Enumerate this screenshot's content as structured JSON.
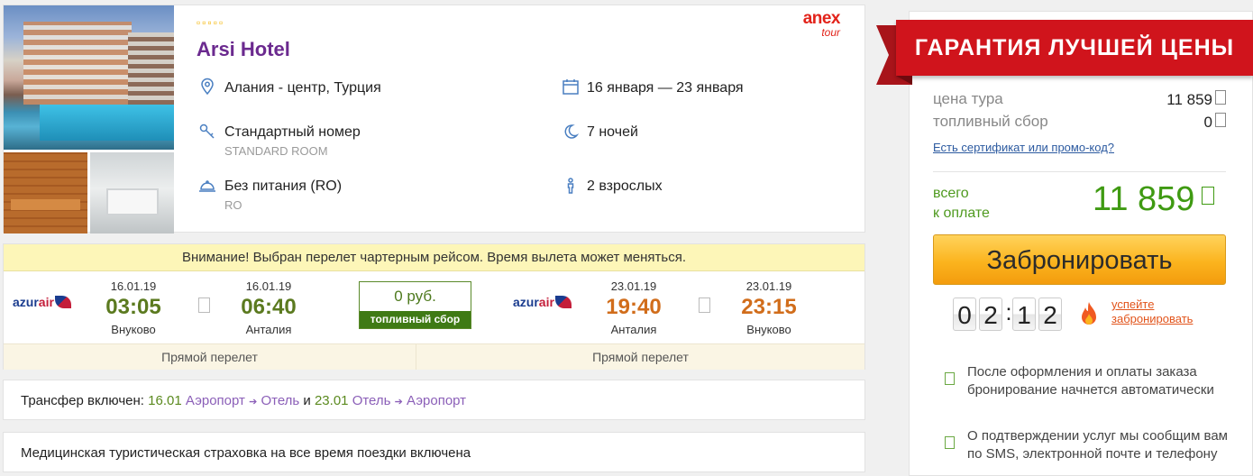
{
  "hotel": {
    "stars": "▫▫▫▫▫",
    "name": "Arsi Hotel",
    "operator_top": "anex",
    "operator_bottom": "tour",
    "location": "Алания - центр, Турция",
    "dates": "16 января — 23 января",
    "room": "Стандартный номер",
    "room_sub": "STANDARD ROOM",
    "nights": "7 ночей",
    "meal": "Без питания (RO)",
    "meal_sub": "RO",
    "guests": "2 взрослых",
    "icons": [
      "location-pin-icon",
      "calendar-icon",
      "room-key-icon",
      "moon-icon",
      "meal-cloche-icon",
      "person-icon"
    ]
  },
  "flight": {
    "warning": "Внимание! Выбран перелет чартерным рейсом. Время вылета может меняться.",
    "outbound": {
      "airline_a": "azur",
      "airline_b": "air",
      "dep_date": "16.01.19",
      "dep_time": "03:05",
      "dep_city": "Внуково",
      "arr_date": "16.01.19",
      "arr_time": "06:40",
      "arr_city": "Анталия",
      "label": "Прямой перелет"
    },
    "fuel": {
      "value": "0 руб.",
      "label": "топливный сбор"
    },
    "return": {
      "airline_a": "azur",
      "airline_b": "air",
      "dep_date": "23.01.19",
      "dep_time": "19:40",
      "dep_city": "Анталия",
      "arr_date": "23.01.19",
      "arr_time": "23:15",
      "arr_city": "Внуково",
      "label": "Прямой перелет"
    }
  },
  "transfer": {
    "prefix": "Трансфер включен:",
    "date1": "16.01",
    "from1": "Аэропорт",
    "to1": "Отель",
    "and": "и",
    "date2": "23.01",
    "from2": "Отель",
    "to2": "Аэропорт"
  },
  "insurance": "Медицинская туристическая страховка на все время поездки включена",
  "sidebar": {
    "banner": "ГАРАНТИЯ ЛУЧШЕЙ ЦЕНЫ",
    "tour_price_label": "цена тура",
    "tour_price": "11 859",
    "fuel_label": "топливный сбор",
    "fuel_value": "0",
    "promo": "Есть сертификат или промо-код?",
    "total_label_1": "всего",
    "total_label_2": "к оплате",
    "total": "11 859",
    "book_button": "Забронировать",
    "timer": {
      "d1": "0",
      "d2": "2",
      "sep": ":",
      "d3": "1",
      "d4": "2"
    },
    "hurry_1": "успейте",
    "hurry_2": "забронировать",
    "notes": [
      "После оформления и оплаты заказа бронирование начнется автоматически",
      "О подтверждении услуг мы сообщим вам по SMS, электронной почте и телефону"
    ],
    "colors": {
      "accent_red": "#d0141c",
      "price_green": "#3f9a12",
      "button_orange": "#fbb41e"
    }
  }
}
